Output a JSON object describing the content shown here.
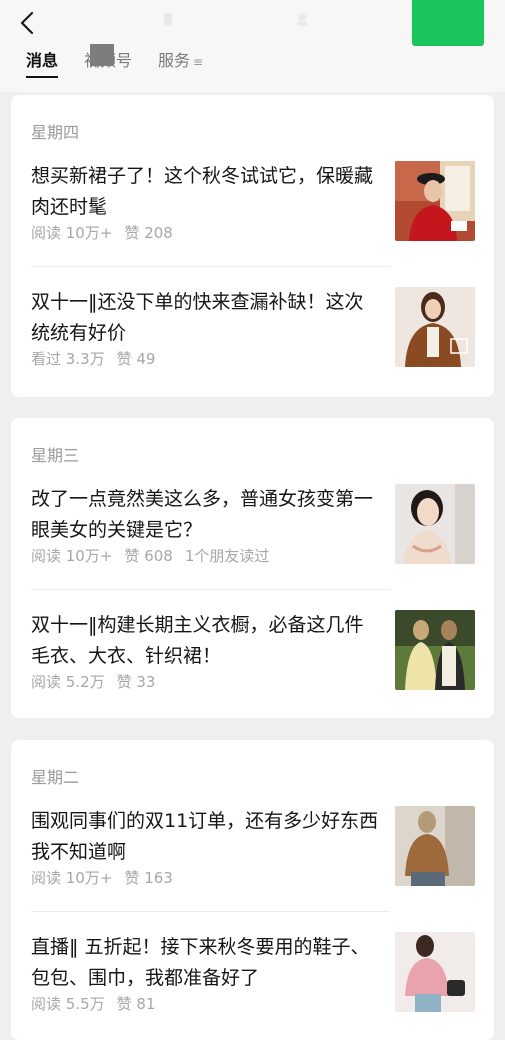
{
  "header": {
    "back_icon": "chevron-left-icon",
    "accent_color": "#19c45a"
  },
  "tabs": [
    {
      "label": "消息",
      "active": true
    },
    {
      "label": "视频号",
      "active": false
    },
    {
      "label": "服务",
      "active": false,
      "icon": "menu-lines-icon"
    }
  ],
  "groups": [
    {
      "day": "星期四",
      "articles": [
        {
          "title": "想买新裙子了！这个秋冬试试它，保暖藏肉还时髦",
          "meta": [
            "阅读 10万+",
            "赞 208"
          ],
          "thumb": "woman-red-coat-photo"
        },
        {
          "title": "双十一‖还没下单的快来查漏补缺！这次统统有好价",
          "meta": [
            "看过 3.3万",
            "赞 49"
          ],
          "thumb": "woman-brown-jacket-photo"
        }
      ]
    },
    {
      "day": "星期三",
      "articles": [
        {
          "title": "改了一点竟然美这么多，普通女孩变第一眼美女的关键是它？",
          "meta": [
            "阅读 10万+",
            "赞 608",
            "1个朋友读过"
          ],
          "thumb": "woman-portrait-photo"
        },
        {
          "title": "双十一‖构建长期主义衣橱，必备这几件毛衣、大衣、针织裙！",
          "meta": [
            "阅读 5.2万",
            "赞 33"
          ],
          "thumb": "two-women-knitwear-photo"
        }
      ]
    },
    {
      "day": "星期二",
      "articles": [
        {
          "title": "围观同事们的双11订单，还有多少好东西我不知道啊",
          "meta": [
            "阅读 10万+",
            "赞 163"
          ],
          "thumb": "man-brown-sweater-photo"
        },
        {
          "title": "直播‖ 五折起！接下来秋冬要用的鞋子、包包、围巾，我都准备好了",
          "meta": [
            "阅读 5.5万",
            "赞 81"
          ],
          "thumb": "woman-pink-sweater-photo"
        }
      ]
    }
  ]
}
